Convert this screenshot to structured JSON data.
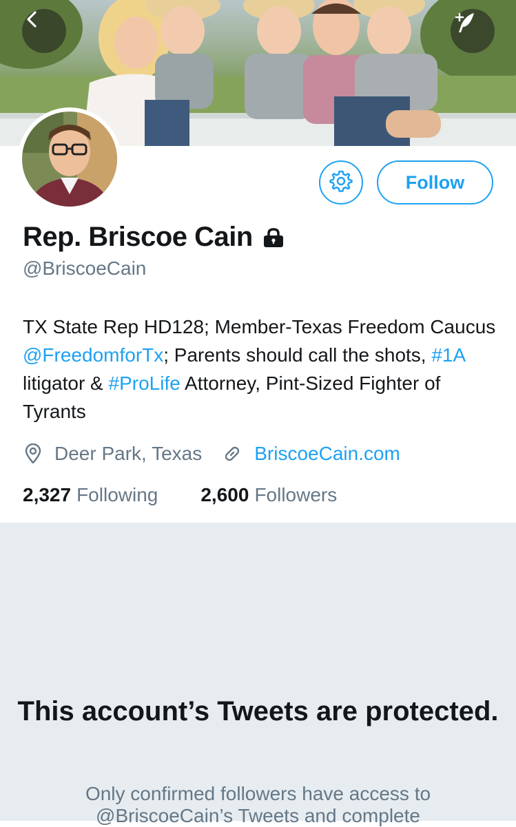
{
  "profile": {
    "display_name": "Rep. Briscoe Cain",
    "handle": "@BriscoeCain",
    "bio": {
      "part1": "TX State Rep HD128; Member-Texas Freedom Caucus ",
      "mention": "@FreedomforTx",
      "part2": "; Parents should call the shots, ",
      "hashtag1": "#1A",
      "part3": " litigator & ",
      "hashtag2": "#ProLife",
      "part4": " Attorney, Pint-Sized Fighter of Tyrants"
    },
    "location": "Deer Park, Texas",
    "website": "BriscoeCain.com",
    "following_count": "2,327",
    "following_label": "Following",
    "followers_count": "2,600",
    "followers_label": "Followers"
  },
  "actions": {
    "follow_label": "Follow"
  },
  "protected": {
    "title": "This account’s Tweets are protected.",
    "body": "Only confirmed followers have access to @BriscoeCain’s Tweets and complete"
  },
  "icons": {
    "back": "chevron-left-icon",
    "compose": "compose-tweet-icon",
    "settings": "gear-icon",
    "lock": "lock-icon",
    "location": "location-pin-icon",
    "link": "link-icon"
  },
  "colors": {
    "accent": "#1da1f2",
    "text_primary": "#14171a",
    "text_secondary": "#657786",
    "protected_background": "#e6ecf0"
  }
}
